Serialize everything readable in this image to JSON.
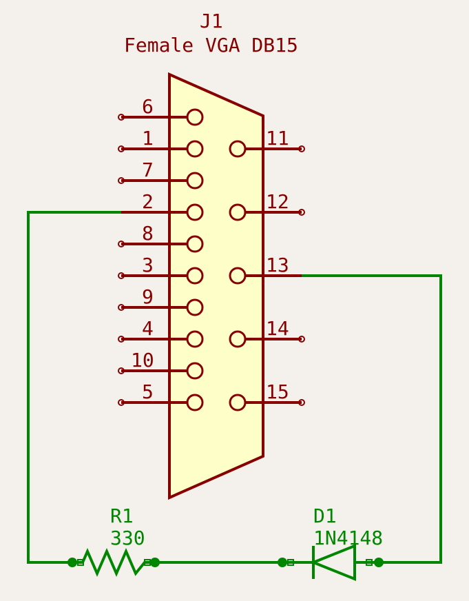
{
  "connector": {
    "ref": "J1",
    "value": "Female VGA DB15",
    "pins_left": [
      "6",
      "1",
      "7",
      "2",
      "8",
      "3",
      "9",
      "4",
      "10",
      "5"
    ],
    "pins_right": [
      "11",
      "12",
      "13",
      "14",
      "15"
    ]
  },
  "resistor": {
    "ref": "R1",
    "value": "330"
  },
  "diode": {
    "ref": "D1",
    "value": "1N4148"
  }
}
